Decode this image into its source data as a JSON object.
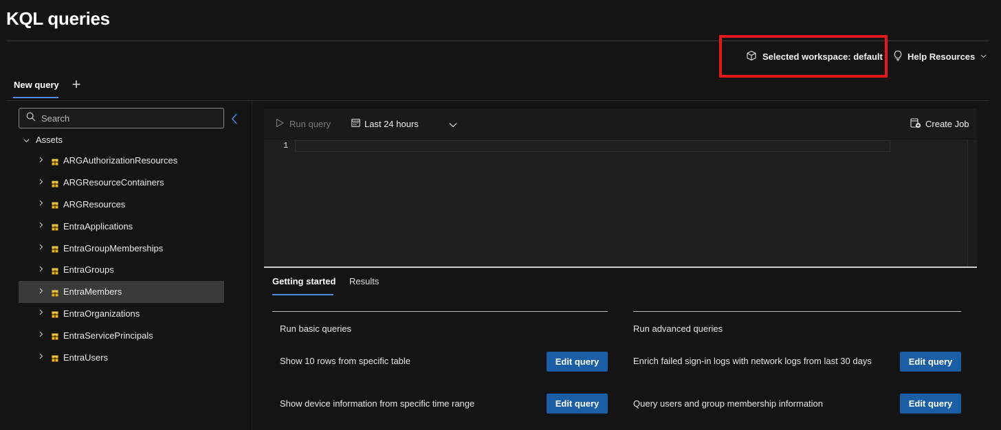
{
  "header": {
    "title": "KQL queries",
    "workspace_label": "Selected workspace: default",
    "help_label": "Help Resources"
  },
  "tabs": {
    "active_label": "New query",
    "add_label": "+"
  },
  "sidebar": {
    "search_placeholder": "Search",
    "assets_label": "Assets",
    "items": [
      {
        "label": "ARGAuthorizationResources"
      },
      {
        "label": "ARGResourceContainers"
      },
      {
        "label": "ARGResources"
      },
      {
        "label": "EntraApplications"
      },
      {
        "label": "EntraGroupMemberships"
      },
      {
        "label": "EntraGroups"
      },
      {
        "label": "EntraMembers",
        "selected": true
      },
      {
        "label": "EntraOrganizations"
      },
      {
        "label": "EntraServicePrincipals"
      },
      {
        "label": "EntraUsers"
      }
    ]
  },
  "toolbar": {
    "run_label": "Run query",
    "time_range": "Last 24 hours",
    "create_job_label": "Create Job"
  },
  "editor": {
    "line_number": "1"
  },
  "results": {
    "tab_getting_started": "Getting started",
    "tab_results": "Results",
    "basic": {
      "heading": "Run basic queries",
      "q1": "Show 10 rows from specific table",
      "q2": "Show device information from specific time range"
    },
    "advanced": {
      "heading": "Run advanced queries",
      "q1": "Enrich failed sign-in logs with network logs from last 30 days",
      "q2": "Query users and group membership information"
    },
    "edit_label": "Edit query"
  },
  "colors": {
    "accent": "#4f8ce0",
    "button": "#1b5ea6",
    "highlight_box": "#e01818",
    "table_icon": "#e8b21a"
  }
}
